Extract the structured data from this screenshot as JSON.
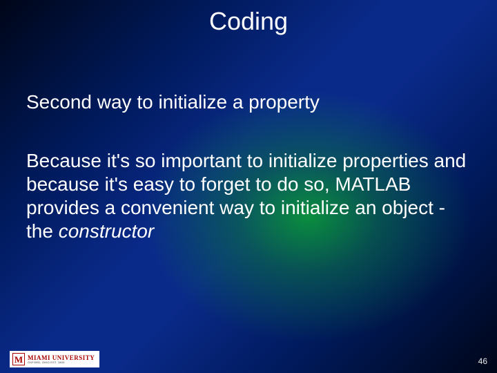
{
  "slide": {
    "title": "Coding",
    "subtitle": "Second way to initialize a property",
    "body_prefix": "Because it's so important to initialize properties and because it's easy to forget to do so, MATLAB provides a convenient way to initialize an object - the ",
    "body_italic": "constructor",
    "page_number": "46"
  },
  "logo": {
    "letter": "M",
    "university": "MIAMI UNIVERSITY",
    "subtitle": "OXFORD, OHIO   EST. 1809"
  }
}
